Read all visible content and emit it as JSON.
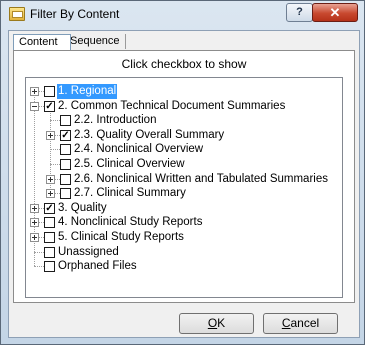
{
  "window": {
    "title": "Filter By Content",
    "help_label": "?",
    "close_label": "✕"
  },
  "tabs": [
    {
      "label": "Content"
    },
    {
      "label": "Sequence"
    }
  ],
  "panel": {
    "instruction": "Click checkbox to show"
  },
  "tree": [
    {
      "label": "1. Regional",
      "checked": false,
      "expander": "plus",
      "selected": true
    },
    {
      "label": "2. Common Technical Document Summaries",
      "checked": true,
      "expander": "minus",
      "selected": false
    },
    {
      "label": "2.2. Introduction",
      "checked": false,
      "expander": "none",
      "selected": false
    },
    {
      "label": "2.3. Quality Overall Summary",
      "checked": true,
      "expander": "plus",
      "selected": false
    },
    {
      "label": "2.4. Nonclinical Overview",
      "checked": false,
      "expander": "none",
      "selected": false
    },
    {
      "label": "2.5. Clinical Overview",
      "checked": false,
      "expander": "none",
      "selected": false
    },
    {
      "label": "2.6. Nonclinical Written and Tabulated Summaries",
      "checked": false,
      "expander": "plus",
      "selected": false
    },
    {
      "label": "2.7. Clinical Summary",
      "checked": false,
      "expander": "plus",
      "selected": false
    },
    {
      "label": "3. Quality",
      "checked": true,
      "expander": "plus",
      "selected": false
    },
    {
      "label": "4. Nonclinical Study Reports",
      "checked": false,
      "expander": "plus",
      "selected": false
    },
    {
      "label": "5. Clinical Study Reports",
      "checked": false,
      "expander": "plus",
      "selected": false
    },
    {
      "label": "Unassigned",
      "checked": false,
      "expander": "none",
      "selected": false
    },
    {
      "label": "Orphaned Files",
      "checked": false,
      "expander": "none",
      "selected": false
    }
  ],
  "buttons": {
    "ok_accel": "O",
    "ok_rest": "K",
    "cancel_accel": "C",
    "cancel_rest": "ancel"
  },
  "colors": {
    "selection": "#3399ff",
    "close": "#c8492f"
  }
}
